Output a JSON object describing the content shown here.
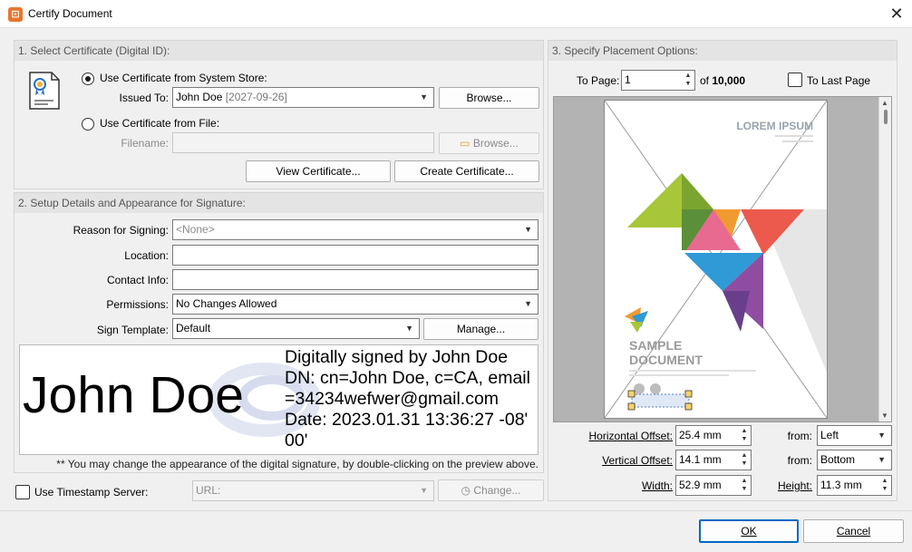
{
  "window": {
    "title": "Certify Document",
    "app_icon": "pdf-xchange-icon"
  },
  "section1": {
    "title": "1. Select Certificate (Digital ID):",
    "opt_system_store": "Use Certificate from System Store:",
    "issued_to_label": "Issued To:",
    "issued_to_name": "John Doe",
    "issued_to_date": "[2027-09-26]",
    "browse_label": "Browse...",
    "opt_file": "Use Certificate from File:",
    "filename_label": "Filename:",
    "filename_value": "",
    "browse_file_label": "Browse...",
    "view_cert_label": "View Certificate...",
    "create_cert_label": "Create Certificate..."
  },
  "section2": {
    "title": "2. Setup Details and Appearance for Signature:",
    "reason_label": "Reason for Signing:",
    "reason_value": "<None>",
    "location_label": "Location:",
    "location_value": "",
    "contact_label": "Contact Info:",
    "contact_value": "",
    "permissions_label": "Permissions:",
    "permissions_value": "No Changes Allowed",
    "template_label": "Sign Template:",
    "template_value": "Default",
    "manage_label": "Manage...",
    "signature_name": "John Doe",
    "signature_lines": [
      "Digitally signed by John Doe",
      "DN: cn=John Doe, c=CA, email",
      "=34234wefwer@gmail.com",
      "Date: 2023.01.31 13:36:27 -08'",
      "00'"
    ],
    "note": "** You may change the appearance of the digital signature, by double-clicking on the preview above."
  },
  "timestamp": {
    "label": "Use Timestamp Server:",
    "url_placeholder": "URL:",
    "change_label": "Change..."
  },
  "section3": {
    "title": "3. Specify Placement Options:",
    "to_page_label": "To Page:",
    "to_page_value": "1",
    "of_label": "of",
    "of_total": "10,000",
    "to_last_page_label": "To Last Page",
    "page_heading": "LOREM IPSUM",
    "page_title_1": "SAMPLE",
    "page_title_2": "DOCUMENT",
    "h_offset_label": "Horizontal Offset:",
    "h_offset_value": "25.4 mm",
    "v_offset_label": "Vertical Offset:",
    "v_offset_value": "14.1 mm",
    "width_label": "Width:",
    "width_value": "52.9 mm",
    "from_label": "from:",
    "from_h_value": "Left",
    "from_v_value": "Bottom",
    "height_label": "Height:",
    "height_value": "11.3 mm"
  },
  "footer": {
    "ok_label": "OK",
    "cancel_label": "Cancel"
  },
  "colors": {
    "accent": "#0067c0",
    "app_icon": "#e8762d"
  }
}
